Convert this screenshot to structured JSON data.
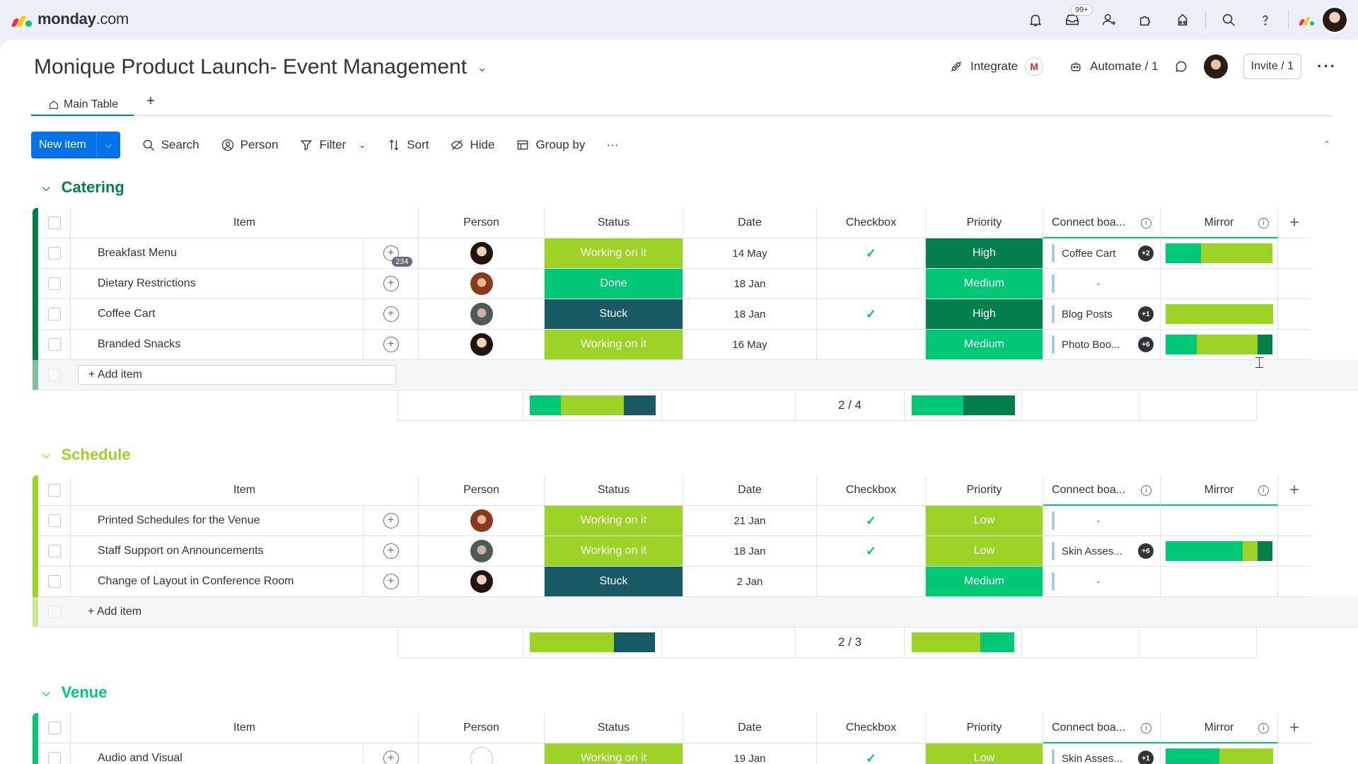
{
  "app": {
    "logo_text": "monday",
    "logo_suffix": ".com",
    "notifications_badge": "99+"
  },
  "colors": {
    "working": "#9cd326",
    "done": "#00c875",
    "stuck": "#175a63",
    "high": "#037f4c",
    "medium": "#00c875",
    "low": "#9cd326",
    "primary": "#0073ea",
    "catering": "#037f4c",
    "schedule": "#9cd326",
    "venue": "#00c875"
  },
  "board": {
    "title": "Monique Product Launch- Event Management",
    "integrate_label": "Integrate",
    "automate_label": "Automate / 1",
    "invite_label": "Invite / 1",
    "tab_main": "Main Table",
    "tab_add": "+"
  },
  "toolbar": {
    "new_item": "New item",
    "search": "Search",
    "person": "Person",
    "filter": "Filter",
    "sort": "Sort",
    "hide": "Hide",
    "group_by": "Group by",
    "more": "···"
  },
  "columns": {
    "item": "Item",
    "person": "Person",
    "status": "Status",
    "date": "Date",
    "checkbox": "Checkbox",
    "priority": "Priority",
    "connect": "Connect boa...",
    "mirror": "Mirror",
    "add": "+"
  },
  "add_item_label": "+ Add item",
  "groups": [
    {
      "name": "Catering",
      "color": "#037f4c",
      "rows": [
        {
          "item": "Breakfast Menu",
          "updates": "234",
          "person": "a",
          "status": "Working on it",
          "status_color": "#9cd326",
          "date": "14 May",
          "checked": true,
          "priority": "High",
          "priority_color": "#037f4c",
          "connect": "Coffee Cart",
          "connect_badge": "+2",
          "mirror": [
            [
              "#00c875",
              0.33
            ],
            [
              "#9cd326",
              0.67
            ]
          ]
        },
        {
          "item": "Dietary Restrictions",
          "updates": "",
          "person": "b",
          "status": "Done",
          "status_color": "#00c875",
          "date": "18 Jan",
          "checked": false,
          "priority": "Medium",
          "priority_color": "#00c875",
          "connect": "-",
          "connect_badge": "",
          "mirror": []
        },
        {
          "item": "Coffee Cart",
          "updates": "",
          "person": "c",
          "status": "Stuck",
          "status_color": "#175a63",
          "date": "18 Jan",
          "checked": true,
          "priority": "High",
          "priority_color": "#037f4c",
          "connect": "Blog Posts",
          "connect_badge": "+1",
          "mirror": [
            [
              "#9cd326",
              1.0
            ]
          ]
        },
        {
          "item": "Branded Snacks",
          "updates": "",
          "person": "a",
          "status": "Working on it",
          "status_color": "#9cd326",
          "date": "16 May",
          "checked": false,
          "priority": "Medium",
          "priority_color": "#00c875",
          "connect": "Photo Boo...",
          "connect_badge": "+6",
          "mirror": [
            [
              "#00c875",
              0.29
            ],
            [
              "#9cd326",
              0.57
            ],
            [
              "#037f4c",
              0.14
            ]
          ]
        }
      ],
      "summary_status": [
        [
          "#00c875",
          0.25
        ],
        [
          "#9cd326",
          0.5
        ],
        [
          "#175a63",
          0.25
        ]
      ],
      "summary_checkbox": "2 / 4",
      "summary_priority": [
        [
          "#00c875",
          0.5
        ],
        [
          "#037f4c",
          0.5
        ]
      ]
    },
    {
      "name": "Schedule",
      "color": "#9cd326",
      "rows": [
        {
          "item": "Printed Schedules for the Venue",
          "updates": "",
          "person": "b",
          "status": "Working on it",
          "status_color": "#9cd326",
          "date": "21 Jan",
          "checked": true,
          "priority": "Low",
          "priority_color": "#9cd326",
          "connect": "-",
          "connect_badge": "",
          "mirror": []
        },
        {
          "item": "Staff Support on Announcements",
          "updates": "",
          "person": "c",
          "status": "Working on it",
          "status_color": "#9cd326",
          "date": "18 Jan",
          "checked": true,
          "priority": "Low",
          "priority_color": "#9cd326",
          "connect": "Skin Asses...",
          "connect_badge": "+6",
          "mirror": [
            [
              "#00c875",
              0.72
            ],
            [
              "#9cd326",
              0.14
            ],
            [
              "#037f4c",
              0.14
            ]
          ]
        },
        {
          "item": "Change of Layout in Conference Room",
          "updates": "",
          "person": "a",
          "status": "Stuck",
          "status_color": "#175a63",
          "date": "2 Jan",
          "checked": false,
          "priority": "Medium",
          "priority_color": "#00c875",
          "connect": "-",
          "connect_badge": "",
          "mirror": []
        }
      ],
      "summary_status": [
        [
          "#9cd326",
          0.67
        ],
        [
          "#175a63",
          0.33
        ]
      ],
      "summary_checkbox": "2 / 3",
      "summary_priority": [
        [
          "#9cd326",
          0.67
        ],
        [
          "#00c875",
          0.33
        ]
      ]
    },
    {
      "name": "Venue",
      "color": "#00c875",
      "rows": [
        {
          "item": "Audio and Visual",
          "updates": "",
          "person": "empty",
          "status": "Working on it",
          "status_color": "#9cd326",
          "date": "19 Jan",
          "checked": true,
          "priority": "Low",
          "priority_color": "#9cd326",
          "connect": "Skin Asses...",
          "connect_badge": "+1",
          "mirror": [
            [
              "#00c875",
              0.5
            ],
            [
              "#9cd326",
              0.5
            ]
          ]
        }
      ],
      "summary_status": [],
      "summary_checkbox": "",
      "summary_priority": []
    }
  ]
}
